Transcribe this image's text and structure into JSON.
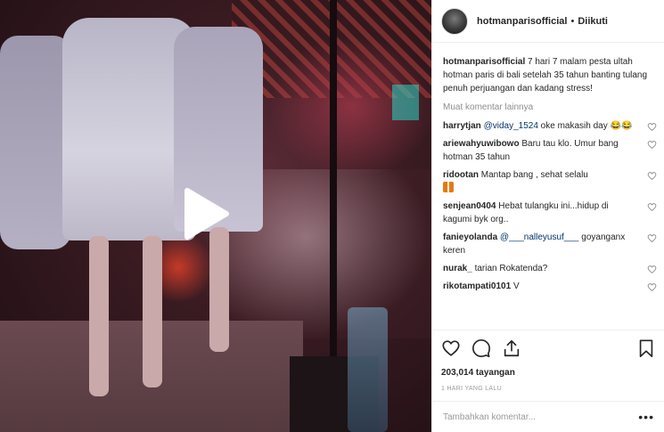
{
  "post": {
    "author": "hotmanparisofficial",
    "follow_status": "Diikuti",
    "separator": "•",
    "caption": "7 hari 7 malam pesta ultah hotman paris di bali setelah 35 tahun banting tulang penuh perjuangan dan kadang stress!"
  },
  "load_more": "Muat komentar lainnya",
  "comments": [
    {
      "user": "harrytjan",
      "mention": "@viday_1524",
      "text": " oke makasih day ",
      "emoji": "😂😂"
    },
    {
      "user": "ariewahyuwibowo",
      "mention": "",
      "text": "Baru tau klo. Umur bang hotman 35 tahun",
      "emoji": ""
    },
    {
      "user": "ridootan",
      "mention": "",
      "text": "Mantap bang , sehat selalu",
      "emoji": "🎁"
    },
    {
      "user": "senjean0404",
      "mention": "",
      "text": "Hebat tulangku ini...hidup di kagumi byk org..",
      "emoji": ""
    },
    {
      "user": "fanieyolanda",
      "mention": "@___nalleyusuf___",
      "text": " goyanganx keren",
      "emoji": ""
    },
    {
      "user": "nurak_",
      "mention": "",
      "text": "tarian Rokatenda?",
      "emoji": ""
    },
    {
      "user": "rikotampati0101",
      "mention": "",
      "text": "V",
      "emoji": ""
    }
  ],
  "stats": {
    "views": "203,014 tayangan",
    "time_ago": "1 HARI YANG LALU"
  },
  "add_comment": {
    "placeholder": "Tambahkan komentar..."
  },
  "icons": {
    "play": "play-icon",
    "like": "heart-icon",
    "comment": "comment-icon",
    "share": "share-icon",
    "save": "bookmark-icon",
    "more": "more-options-icon"
  }
}
